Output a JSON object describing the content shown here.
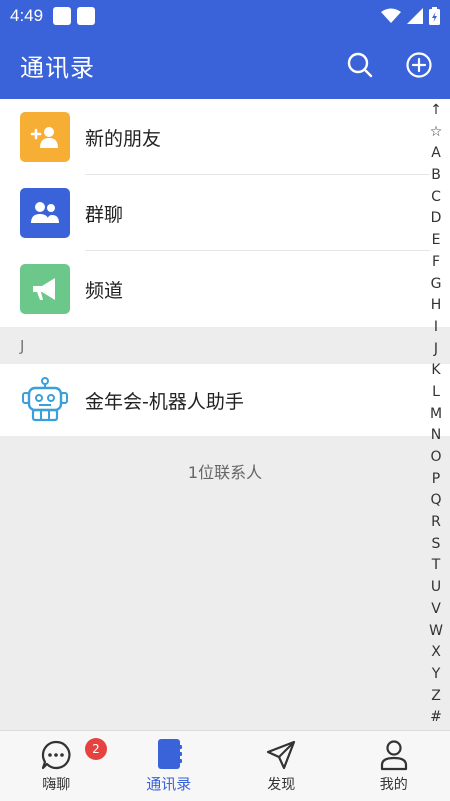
{
  "status_bar": {
    "time": "4:49"
  },
  "app_bar": {
    "title": "通讯录"
  },
  "contacts_menu": [
    {
      "label": "新的朋友",
      "icon": "add-friend-icon",
      "color": "#f6ae34"
    },
    {
      "label": "群聊",
      "icon": "group-icon",
      "color": "#3a63d9"
    },
    {
      "label": "频道",
      "icon": "megaphone-icon",
      "color": "#6cc88a"
    }
  ],
  "sections": [
    {
      "header": "J",
      "contacts": [
        {
          "name": "金年会-机器人助手",
          "icon": "robot-icon"
        }
      ]
    }
  ],
  "contact_count": "1位联系人",
  "index_letters": [
    "↑",
    "☆",
    "A",
    "B",
    "C",
    "D",
    "E",
    "F",
    "G",
    "H",
    "I",
    "J",
    "K",
    "L",
    "M",
    "N",
    "O",
    "P",
    "Q",
    "R",
    "S",
    "T",
    "U",
    "V",
    "W",
    "X",
    "Y",
    "Z",
    "#"
  ],
  "tabs": [
    {
      "label": "嗨聊",
      "icon": "chat-bubble-icon",
      "badge": "2",
      "active": false
    },
    {
      "label": "通讯录",
      "icon": "contacts-book-icon",
      "active": true
    },
    {
      "label": "发现",
      "icon": "send-icon",
      "active": false
    },
    {
      "label": "我的",
      "icon": "person-icon",
      "active": false
    }
  ],
  "colors": {
    "primary": "#3a63d9",
    "badge": "#e64340"
  }
}
